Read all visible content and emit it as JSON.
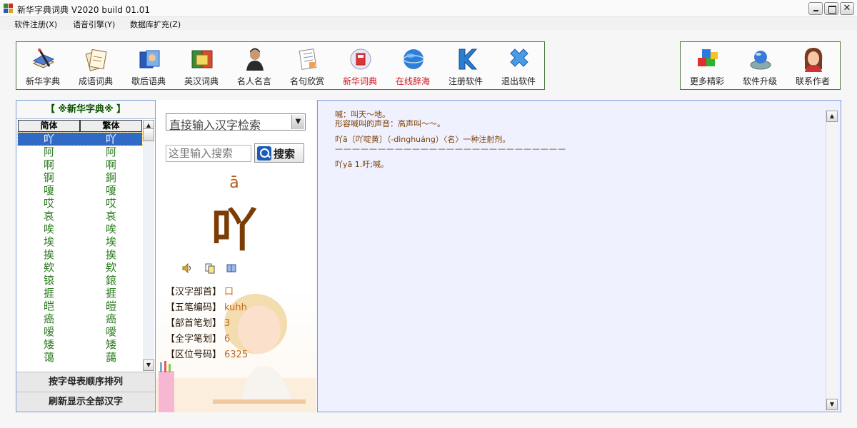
{
  "window": {
    "title": "新华字典词典 V2020 build 01.01"
  },
  "menu": [
    {
      "label": "软件注册(X)"
    },
    {
      "label": "语音引擎(Y)"
    },
    {
      "label": "数据库扩充(Z)"
    }
  ],
  "toolbar": [
    {
      "label": "新华字典",
      "icon": "dictionary-book-icon"
    },
    {
      "label": "成语词典",
      "icon": "idiom-book-icon"
    },
    {
      "label": "歇后语典",
      "icon": "proverb-book-icon"
    },
    {
      "label": "英汉词典",
      "icon": "english-dict-icon"
    },
    {
      "label": "名人名言",
      "icon": "famous-person-icon"
    },
    {
      "label": "名句欣赏",
      "icon": "notebook-icon"
    },
    {
      "label": "新华词典",
      "icon": "xinhua-dict-icon",
      "active": true
    },
    {
      "label": "在线辞海",
      "icon": "globe-icon"
    },
    {
      "label": "注册软件",
      "icon": "register-icon"
    },
    {
      "label": "退出软件",
      "icon": "exit-icon"
    }
  ],
  "toolbar_right": [
    {
      "label": "更多精彩",
      "icon": "cubes-icon"
    },
    {
      "label": "软件升级",
      "icon": "upgrade-icon"
    },
    {
      "label": "联系作者",
      "icon": "author-avatar-icon"
    }
  ],
  "left": {
    "header": "【 ※新华字典※ 】",
    "col_simplified": "简体",
    "col_traditional": "繁体",
    "rows": [
      [
        "吖",
        "吖"
      ],
      [
        "阿",
        "阿"
      ],
      [
        "啊",
        "啊"
      ],
      [
        "锕",
        "錒"
      ],
      [
        "嗄",
        "嗄"
      ],
      [
        "哎",
        "哎"
      ],
      [
        "哀",
        "哀"
      ],
      [
        "唉",
        "唉"
      ],
      [
        "埃",
        "埃"
      ],
      [
        "挨",
        "挨"
      ],
      [
        "欸",
        "欸"
      ],
      [
        "锿",
        "鎄"
      ],
      [
        "捱",
        "捱"
      ],
      [
        "皑",
        "皚"
      ],
      [
        "癌",
        "癌"
      ],
      [
        "嗳",
        "噯"
      ],
      [
        "矮",
        "矮"
      ],
      [
        "蔼",
        "藹"
      ]
    ],
    "btn_sort": "按字母表顺序排列",
    "btn_refresh": "刷新显示全部汉字"
  },
  "middle": {
    "select_value": "直接输入汉字检索",
    "search_placeholder": "这里输入搜索",
    "search_button": "搜索",
    "pinyin": "ā",
    "char": "吖",
    "info": [
      {
        "label": "【汉字部首】",
        "value": "口"
      },
      {
        "label": "【五笔编码】",
        "value": "kuhh"
      },
      {
        "label": "【部首笔划】",
        "value": "3"
      },
      {
        "label": "【全字笔划】",
        "value": "6"
      },
      {
        "label": "【区位号码】",
        "value": "6325"
      }
    ]
  },
  "definition": {
    "lines": [
      "喊：叫天～地。",
      "形容喊叫的声音：高声叫～～。",
      "",
      "吖ā〔吖啶黄〕（-dìnghuáng）〈名〉一种注射剂。",
      "———————————————————————————",
      "",
      "吖yā 1.吁;喊。"
    ]
  }
}
